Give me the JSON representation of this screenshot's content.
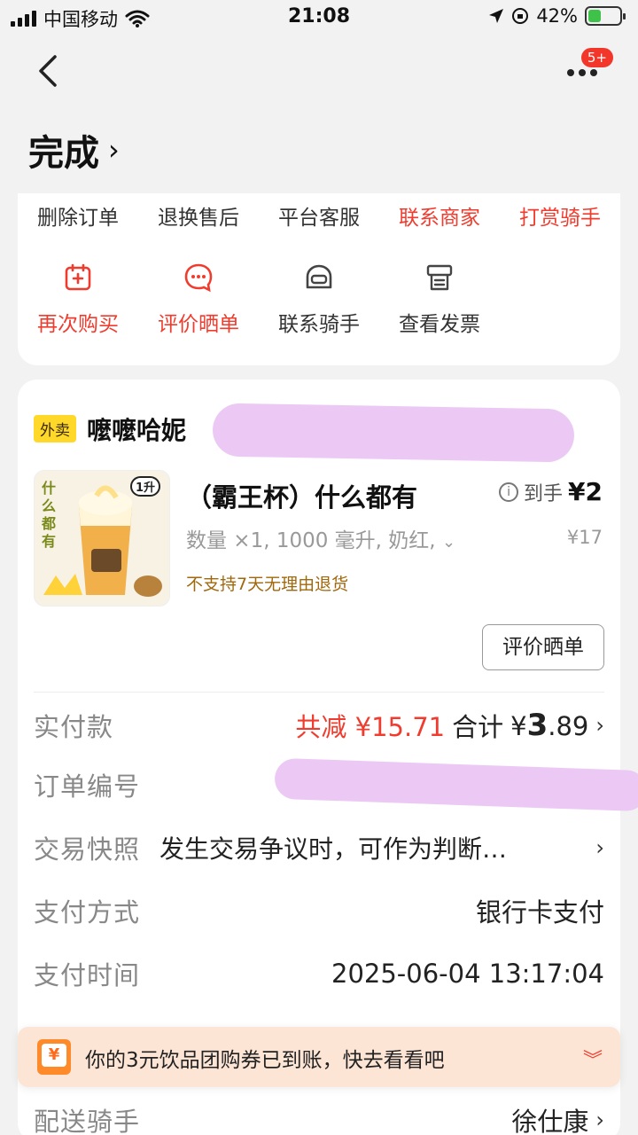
{
  "status_bar": {
    "carrier": "中国移动",
    "time": "21:08",
    "battery": "42%",
    "battery_level": 0.42
  },
  "nav": {
    "badge": "5+"
  },
  "order": {
    "status": "完成"
  },
  "text_actions": [
    {
      "label": "删除订单",
      "highlight": false
    },
    {
      "label": "退换售后",
      "highlight": false
    },
    {
      "label": "平台客服",
      "highlight": false
    },
    {
      "label": "联系商家",
      "highlight": true
    },
    {
      "label": "打赏骑手",
      "highlight": true
    }
  ],
  "icon_actions": [
    {
      "label": "再次购买",
      "icon": "cart-plus-icon",
      "highlight": true
    },
    {
      "label": "评价晒单",
      "icon": "comment-icon",
      "highlight": true
    },
    {
      "label": "联系骑手",
      "icon": "helmet-icon",
      "highlight": false
    },
    {
      "label": "查看发票",
      "icon": "invoice-icon",
      "highlight": false
    }
  ],
  "shop": {
    "tag": "外卖",
    "name": "嚒嚒哈妮"
  },
  "product": {
    "name": "（霸王杯）什么都有",
    "spec": "数量 ×1, 1000 毫升, 奶红,",
    "notice": "不支持7天无理由退货",
    "price_prefix": "到手",
    "price": "¥2",
    "original_price": "¥17",
    "thumb_text": "什么都有",
    "thumb_size": "1升"
  },
  "review_button": "评价晒单",
  "details": {
    "paid_label": "实付款",
    "reduce": "共减 ¥15.71",
    "total_prefix": "合计",
    "total_currency": "¥",
    "total_int": "3",
    "total_dec": ".89",
    "order_no_label": "订单编号",
    "snapshot_label": "交易快照",
    "snapshot_value": "发生交易争议时，可作为判断…",
    "pay_method_label": "支付方式",
    "pay_method_value": "银行卡支付",
    "pay_time_label": "支付时间",
    "pay_time_value": "2025-06-04 13:17:04",
    "rider_label": "配送骑手",
    "rider_value": "徐仕康"
  },
  "toast": {
    "text": "你的3元饮品团购券已到账，快去看看吧"
  },
  "colors": {
    "accent": "#f03c2e",
    "tag_bg": "#ffd82a",
    "toast_bg": "#fde5d6"
  }
}
